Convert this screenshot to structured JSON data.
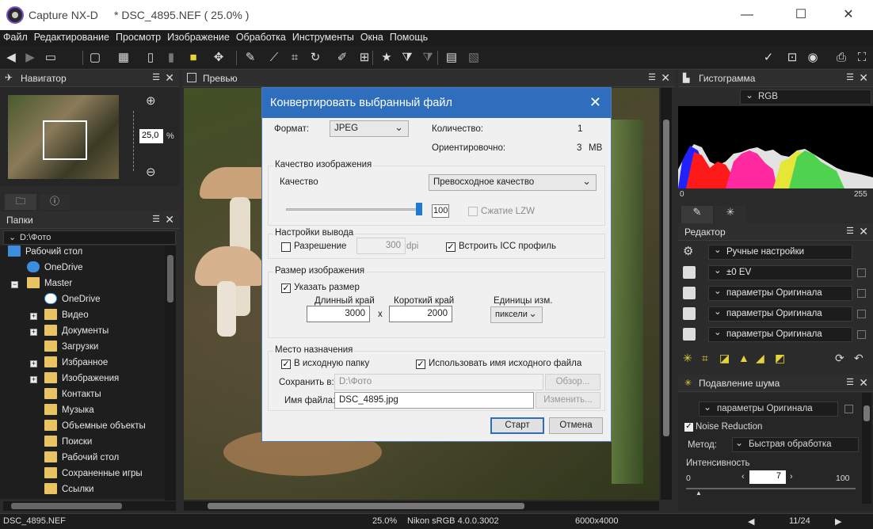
{
  "window": {
    "app": "Capture NX-D",
    "doc": "* DSC_4895.NEF ( 25.0% )"
  },
  "menu": [
    "Файл",
    "Редактирование",
    "Просмотр",
    "Изображение",
    "Обработка",
    "Инструменты",
    "Окна",
    "Помощь"
  ],
  "navigator": {
    "title": "Навигатор",
    "zoom": "25,0",
    "unit": "%"
  },
  "preview": {
    "title": "Превью"
  },
  "folders": {
    "title": "Папки",
    "path": "D:\\Фото",
    "items": [
      "Рабочий стол",
      "OneDrive",
      "Master",
      "OneDrive",
      "Видео",
      "Документы",
      "Загрузки",
      "Избранное",
      "Изображения",
      "Контакты",
      "Музыка",
      "Объемные объекты",
      "Поиски",
      "Рабочий стол",
      "Сохраненные игры",
      "Ссылки"
    ]
  },
  "histogram": {
    "title": "Гистограмма",
    "channel": "RGB",
    "min": "0",
    "max": "255"
  },
  "editor": {
    "title": "Редактор",
    "rows": [
      "Ручные настройки",
      "±0 EV",
      "параметры Оригинала",
      "параметры Оригинала",
      "параметры Оригинала"
    ]
  },
  "noise": {
    "title": "Подавление шума",
    "setting": "параметры Оригинала",
    "nr_label": "Noise Reduction",
    "method_label": "Метод:",
    "method": "Быстрая обработка",
    "intensity_label": "Интенсивность",
    "min": "0",
    "value": "7",
    "max": "100"
  },
  "dialog": {
    "title": "Конвертировать выбранный файл",
    "format_label": "Формат:",
    "format": "JPEG",
    "count_label": "Количество:",
    "count": "1",
    "approx_label": "Ориентировочно:",
    "approx": "3",
    "approx_unit": "MB",
    "quality_group": "Качество изображения",
    "quality_label": "Качество",
    "quality": "Превосходное качество",
    "quality_value": "100",
    "quality_level": 1.0,
    "lzw": "Сжатие LZW",
    "output_group": "Настройки вывода",
    "resolution": "Разрешение",
    "dpi_value": "300",
    "dpi": "dpi",
    "icc": "Встроить ICC профиль",
    "size_group": "Размер изображения",
    "set_size": "Указать размер",
    "long_label": "Длинный край",
    "long": "3000",
    "times": "x",
    "short_label": "Короткий край",
    "short": "2000",
    "units_label": "Единицы изм.",
    "units": "пиксели",
    "dest_group": "Место назначения",
    "src_folder": "В исходную папку",
    "use_name": "Использовать имя исходного файла",
    "save_label": "Сохранить в:",
    "save_path": "D:\\Фото",
    "browse": "Обзор...",
    "name_label": "Имя файла:",
    "name": "DSC_4895.jpg",
    "change": "Изменить...",
    "start": "Старт",
    "cancel": "Отмена"
  },
  "status": {
    "file": "DSC_4895.NEF",
    "zoom": "25.0%",
    "profile": "Nikon sRGB 4.0.0.3002",
    "dims": "6000x4000",
    "index": "11/24"
  }
}
